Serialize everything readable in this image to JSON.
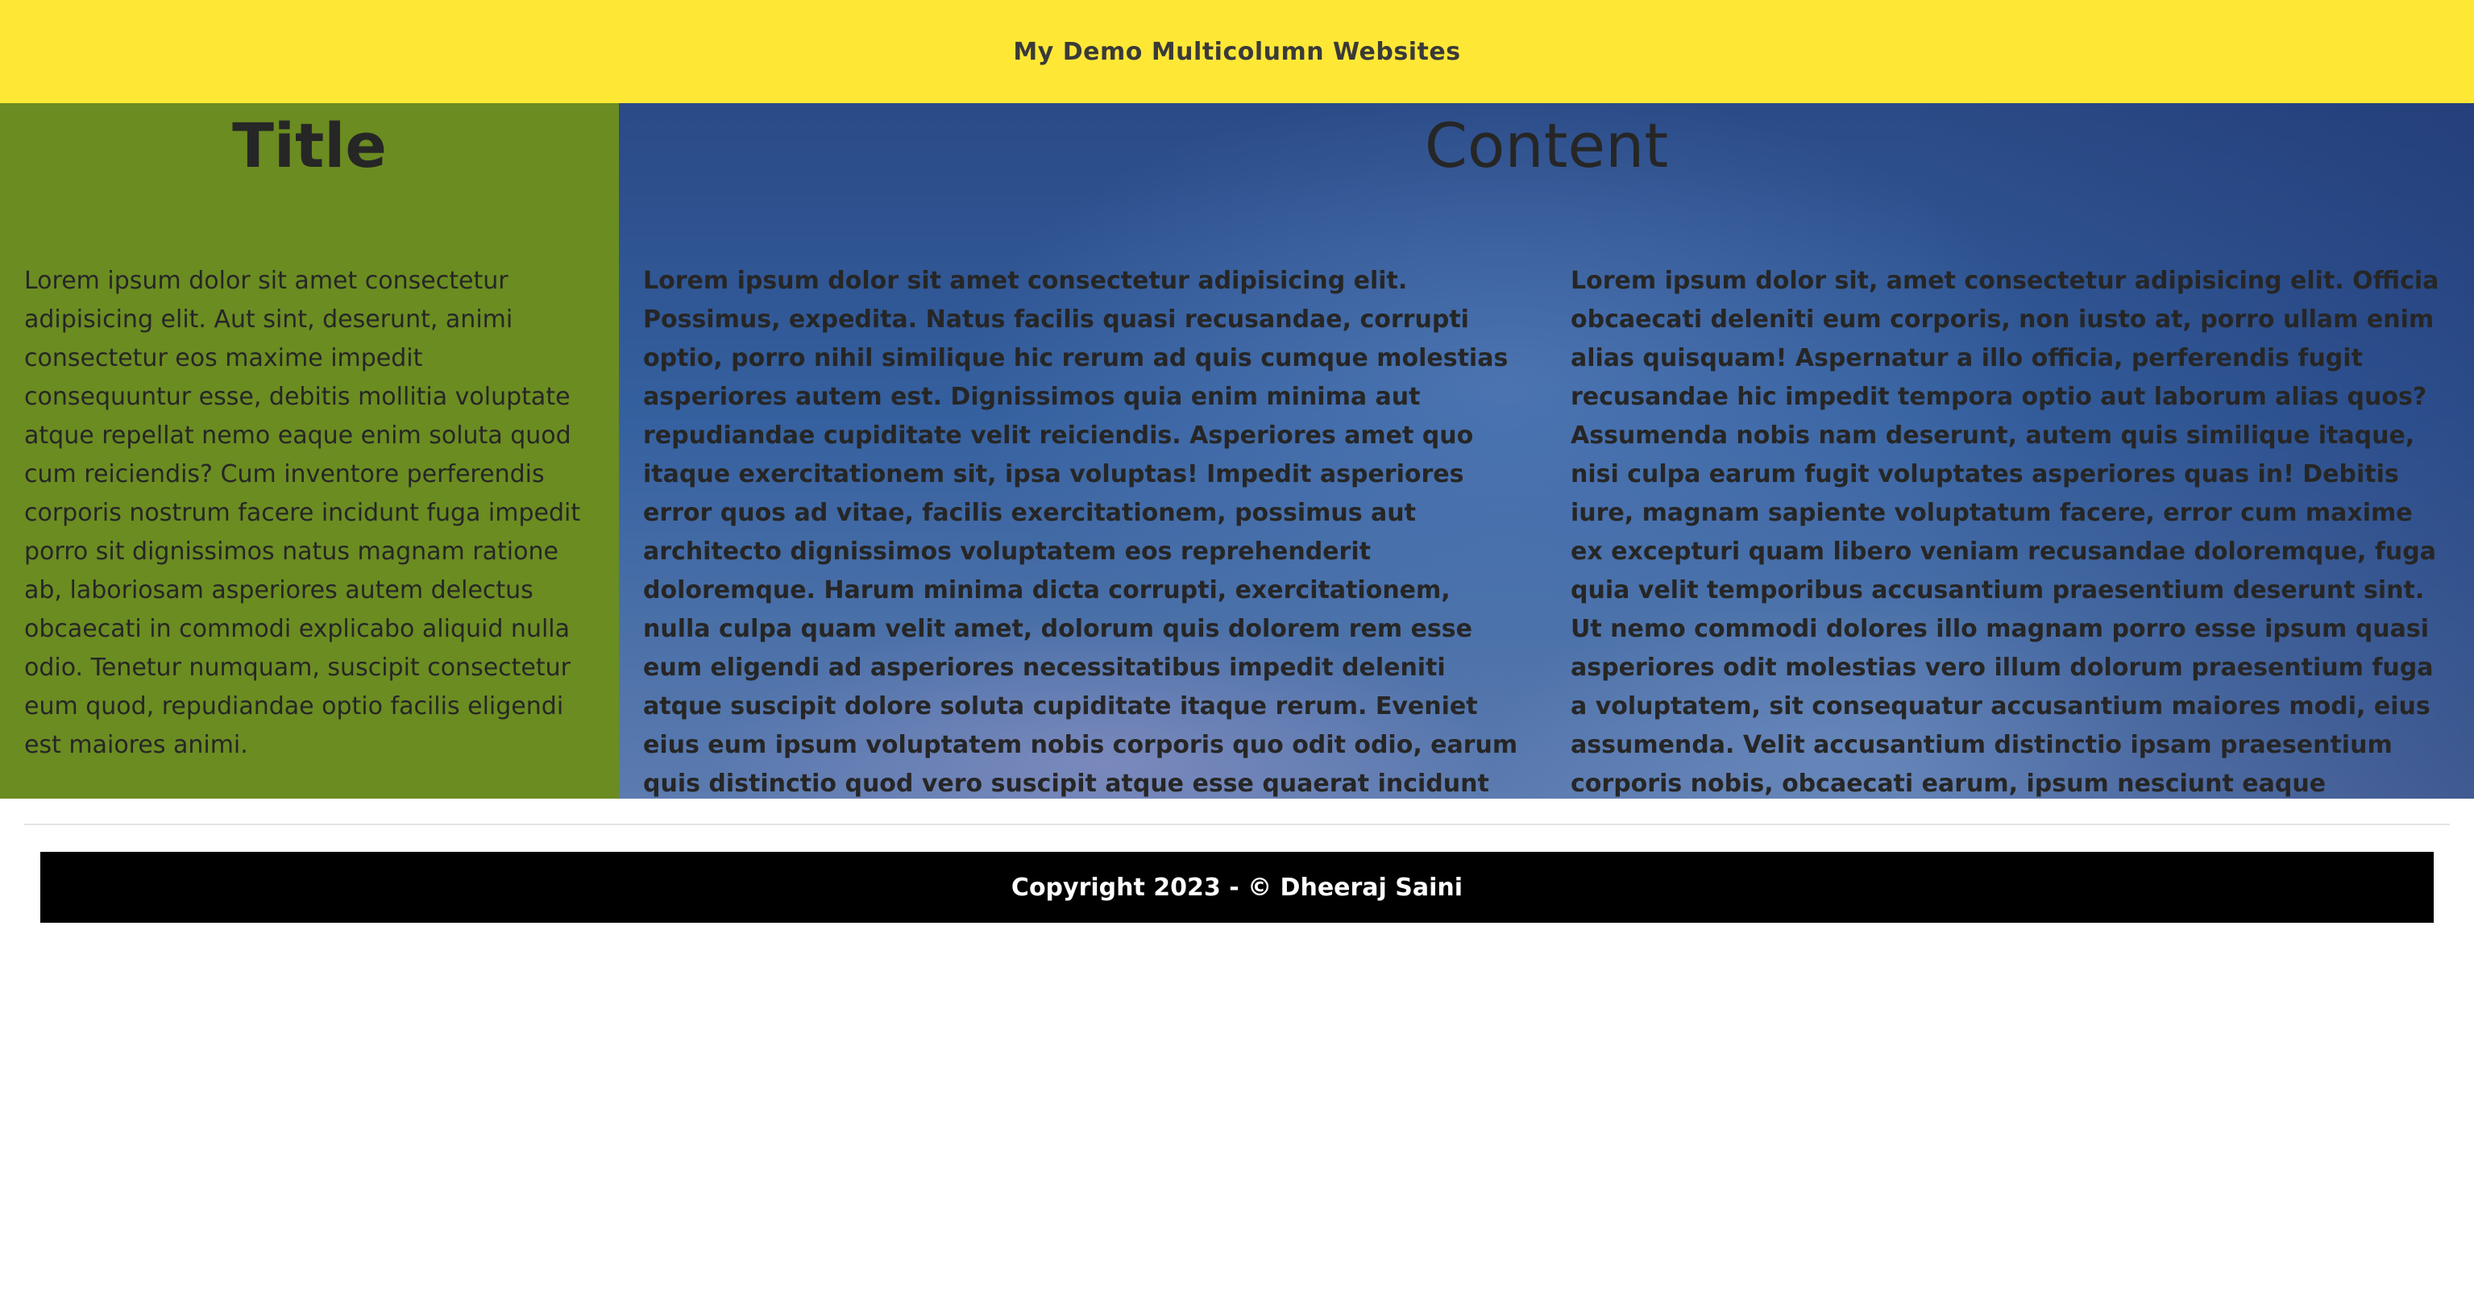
{
  "header": {
    "title": "My Demo Multicolumn Websites"
  },
  "sidebar": {
    "heading": "Title",
    "text": "Lorem ipsum dolor sit amet consectetur adipisicing elit. Aut sint, deserunt, animi consectetur eos maxime impedit consequuntur esse, debitis mollitia voluptate atque repellat nemo eaque enim soluta quod cum reiciendis? Cum inventore perferendis corporis nostrum facere incidunt fuga impedit porro sit dignissimos natus magnam ratione ab, laboriosam asperiores autem delectus obcaecati in commodi explicabo aliquid nulla odio. Tenetur numquam, suscipit consectetur eum quod, repudiandae optio facilis eligendi est maiores animi."
  },
  "main": {
    "heading": "Content",
    "columns": [
      {
        "text": "Lorem ipsum dolor sit amet consectetur adipisicing elit. Possimus, expedita. Natus facilis quasi recusandae, corrupti optio, porro nihil similique hic rerum ad quis cumque molestias asperiores autem est. Dignissimos quia enim minima aut repudiandae cupiditate velit reiciendis. Asperiores amet quo itaque exercitationem sit, ipsa voluptas! Impedit asperiores error quos ad vitae, facilis exercitationem, possimus aut architecto dignissimos voluptatem eos reprehenderit doloremque. Harum minima dicta corrupti, exercitationem, nulla culpa quam velit amet, dolorum quis dolorem rem esse eum eligendi ad asperiores necessitatibus impedit deleniti atque suscipit dolore soluta cupiditate itaque rerum. Eveniet eius eum ipsum voluptatem nobis corporis quo odit odio, earum quis distinctio quod vero suscipit atque esse quaerat incidunt exercitationem animi molestias numquam nam adipisci qui recusandae obcaecati. Ab?"
      },
      {
        "text": "Lorem ipsum dolor sit, amet consectetur adipisicing elit. Officia obcaecati deleniti eum corporis, non iusto at, porro ullam enim alias quisquam! Aspernatur a illo officia, perferendis fugit recusandae hic impedit tempora optio aut laborum alias quos? Assumenda nobis nam deserunt, autem quis similique itaque, nisi culpa earum fugit voluptates asperiores quas in! Debitis iure, magnam sapiente voluptatum facere, error cum maxime ex excepturi quam libero veniam recusandae doloremque, fuga quia velit temporibus accusantium praesentium deserunt sint. Ut nemo commodi dolores illo magnam porro esse ipsum quasi asperiores odit molestias vero illum dolorum praesentium fuga a voluptatem, sit consequatur accusantium maiores modi, eius assumenda. Velit accusantium distinctio ipsam praesentium corporis nobis, obcaecati earum, ipsum nesciunt eaque voluptatum non quaerat cupiditate deleniti?"
      }
    ]
  },
  "footer": {
    "text": "Copyright 2023 - © Dheeraj Saini"
  },
  "colors": {
    "header_bg": "#ffe835",
    "sidebar_bg": "#6b8c21",
    "main_bg": "#2f4f8a",
    "footer_bg": "#000000",
    "text_dark": "#262626",
    "footer_text": "#ffffff"
  }
}
